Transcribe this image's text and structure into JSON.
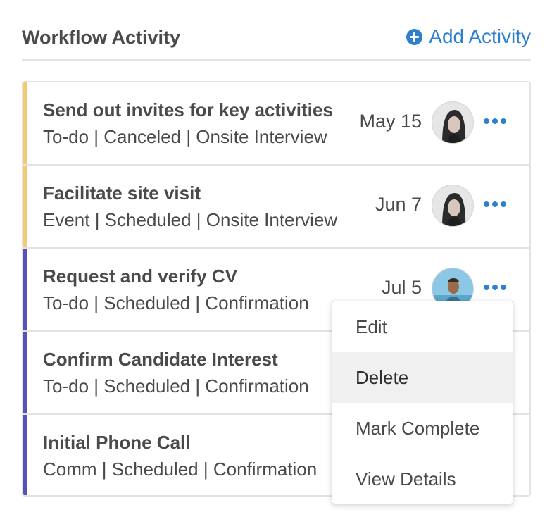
{
  "header": {
    "title": "Workflow Activity",
    "add_label": "Add Activity"
  },
  "colors": {
    "accent_blue": "#2f7fd1",
    "stripe_yellow": "#f4cb72",
    "stripe_purple": "#5852b3"
  },
  "activities": [
    {
      "name": "Send out invites for key activities",
      "meta": "To-do | Canceled | Onsite Interview",
      "date": "May 15",
      "stripe": "yellow",
      "avatar": "woman-portrait"
    },
    {
      "name": "Facilitate site visit",
      "meta": "Event | Scheduled | Onsite Interview",
      "date": "Jun 7",
      "stripe": "yellow",
      "avatar": "woman-portrait"
    },
    {
      "name": "Request and verify CV",
      "meta": "To-do | Scheduled | Confirmation",
      "date": "Jul 5",
      "stripe": "purple",
      "avatar": "man-beach-portrait"
    },
    {
      "name": "Confirm Candidate Interest",
      "meta": "To-do | Scheduled | Confirmation",
      "date": "",
      "stripe": "purple",
      "avatar": ""
    },
    {
      "name": "Initial Phone Call",
      "meta": "Comm | Scheduled | Confirmation",
      "date": "",
      "stripe": "purple",
      "avatar": ""
    }
  ],
  "context_menu": {
    "items": [
      "Edit",
      "Delete",
      "Mark Complete",
      "View Details"
    ],
    "highlighted": "Delete"
  }
}
